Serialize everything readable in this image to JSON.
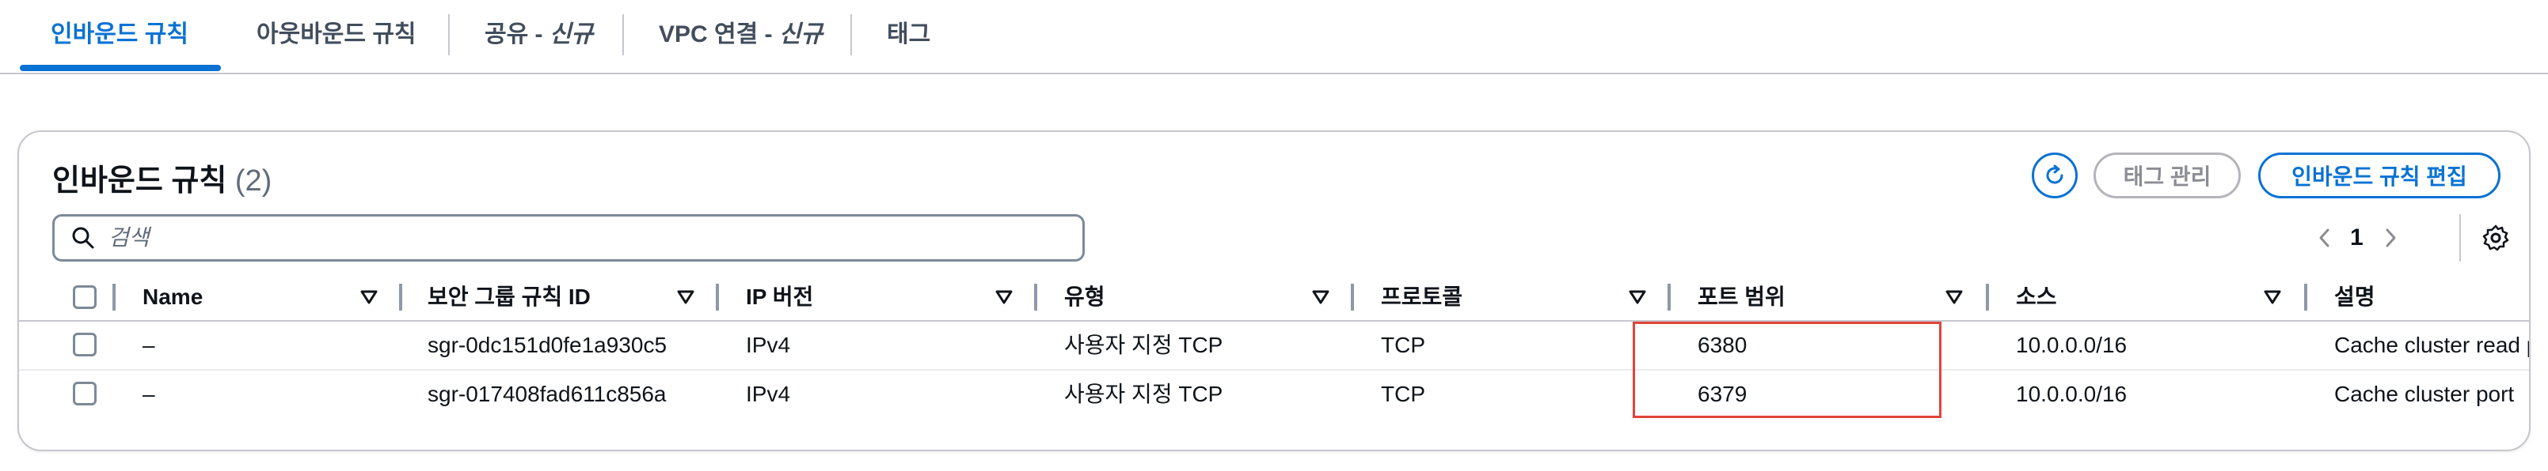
{
  "tabs": {
    "inbound": "인바운드 규칙",
    "outbound": "아웃바운드 규칙",
    "sharing": "공유 - ",
    "sharing_new": "신규",
    "vpc": "VPC 연결 - ",
    "vpc_new": "신규",
    "tags": "태그"
  },
  "panel": {
    "title": "인바운드 규칙",
    "count": "(2)",
    "manage_tags_label": "태그 관리",
    "edit_rules_label": "인바운드 규칙 편집"
  },
  "search": {
    "placeholder": "검색",
    "value": ""
  },
  "pagination": {
    "current_page": "1"
  },
  "table": {
    "columns": [
      "Name",
      "보안 그룹 규칙 ID",
      "IP 버전",
      "유형",
      "프로토콜",
      "포트 범위",
      "소스",
      "설명"
    ],
    "rows": [
      {
        "name": "–",
        "rule_id": "sgr-0dc151d0fe1a930c5",
        "ip_version": "IPv4",
        "type": "사용자 지정 TCP",
        "protocol": "TCP",
        "port_range": "6380",
        "source": "10.0.0.0/16",
        "description": "Cache cluster read port"
      },
      {
        "name": "–",
        "rule_id": "sgr-017408fad611c856a",
        "ip_version": "IPv4",
        "type": "사용자 지정 TCP",
        "protocol": "TCP",
        "port_range": "6379",
        "source": "10.0.0.0/16",
        "description": "Cache cluster port"
      }
    ]
  },
  "colors": {
    "accent": "#0972d3",
    "highlight": "#e0443a",
    "border": "#c6c6cd",
    "text": "#0f141a"
  },
  "icons": [
    "search-icon",
    "refresh-icon",
    "chevron-left-icon",
    "chevron-right-icon",
    "gear-icon",
    "sort-down-icon"
  ]
}
